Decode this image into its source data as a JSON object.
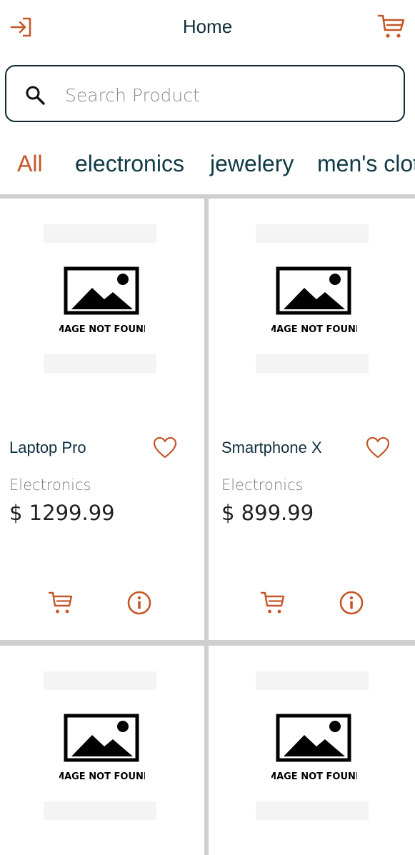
{
  "header": {
    "title": "Home",
    "login_icon": "login-arrow-icon",
    "cart_icon": "cart-icon"
  },
  "search": {
    "placeholder": "Search Product",
    "value": ""
  },
  "categories": [
    "All",
    "electronics",
    "jewelery",
    "men's clothing"
  ],
  "selected_category": "All",
  "products": [
    {
      "name": "Laptop Pro",
      "category": "Electronics",
      "price": "$ 1299.99",
      "image_text": "IMAGE NOT FOUND"
    },
    {
      "name": "Smartphone X",
      "category": "Electronics",
      "price": "$ 899.99",
      "image_text": "IMAGE NOT FOUND"
    },
    {
      "image_text": "IMAGE NOT FOUND"
    },
    {
      "image_text": "IMAGE NOT FOUND"
    }
  ],
  "colors": {
    "accent": "#c4572a",
    "text_dark": "#0f3040",
    "border": "#0f2935",
    "grid_divider": "#cfcfcf"
  }
}
